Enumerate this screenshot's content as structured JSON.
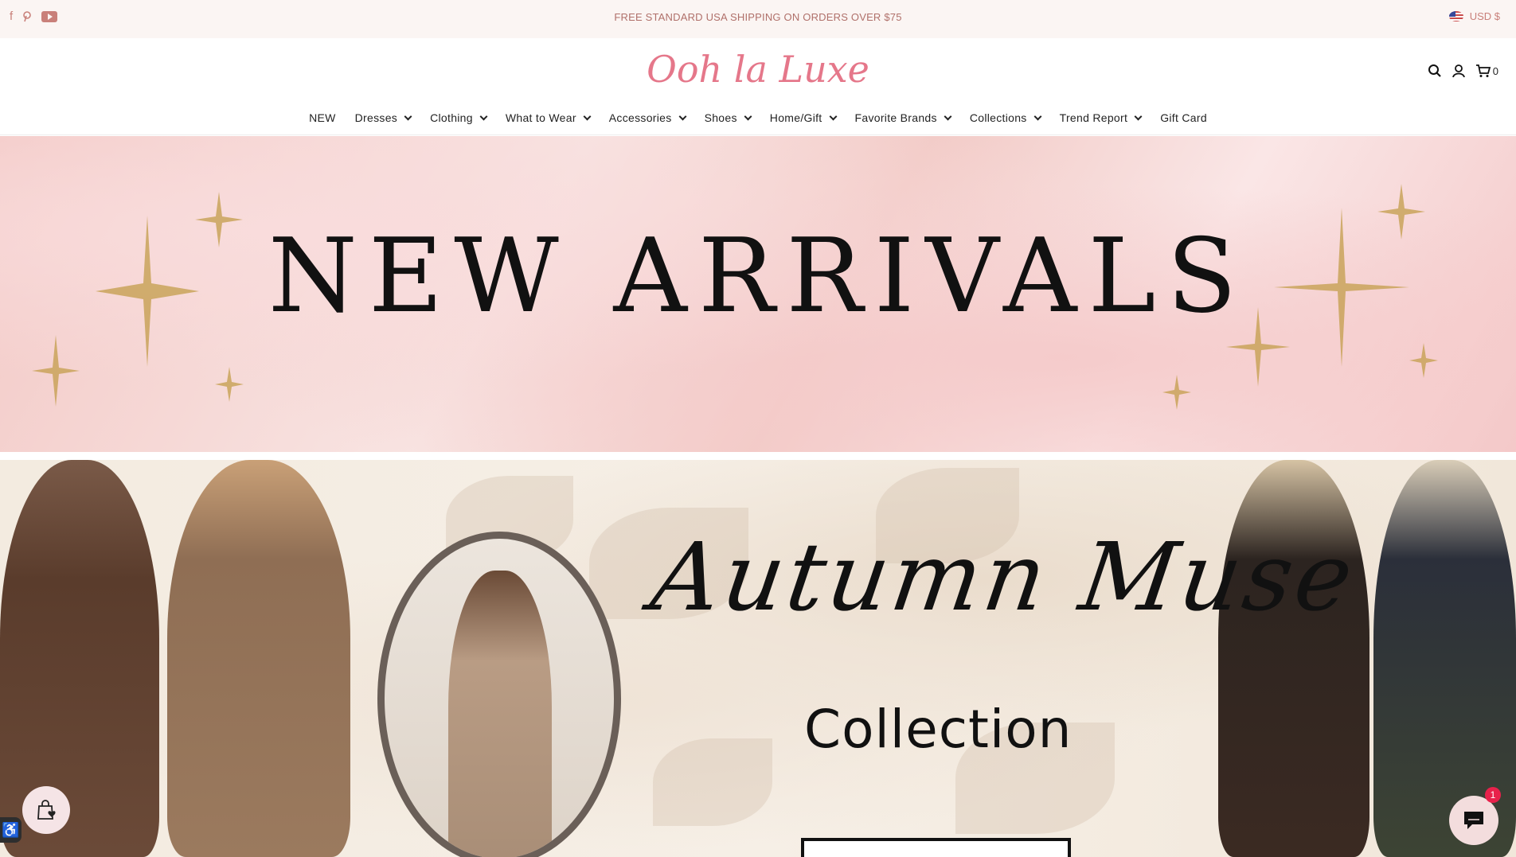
{
  "topbar": {
    "promo": "FREE STANDARD USA SHIPPING ON ORDERS OVER $75",
    "currency": "USD $",
    "social_icons": [
      "facebook-icon",
      "pinterest-icon",
      "youtube-icon"
    ]
  },
  "header": {
    "logo": "Ooh la Luxe",
    "cart_count": "0",
    "icons": [
      "search-icon",
      "account-icon",
      "cart-icon"
    ]
  },
  "nav": {
    "items": [
      {
        "label": "NEW",
        "dropdown": false
      },
      {
        "label": "Dresses",
        "dropdown": true
      },
      {
        "label": "Clothing",
        "dropdown": true
      },
      {
        "label": "What to Wear",
        "dropdown": true
      },
      {
        "label": "Accessories",
        "dropdown": true
      },
      {
        "label": "Shoes",
        "dropdown": true
      },
      {
        "label": "Home/Gift",
        "dropdown": true
      },
      {
        "label": "Favorite Brands",
        "dropdown": true
      },
      {
        "label": "Collections",
        "dropdown": true
      },
      {
        "label": "Trend Report",
        "dropdown": true
      },
      {
        "label": "Gift Card",
        "dropdown": false
      }
    ]
  },
  "hero": {
    "title": "NEW ARRIVALS"
  },
  "feature": {
    "script_title": "Autumn Muse",
    "subtitle": "Collection"
  },
  "chat": {
    "badge": "1"
  },
  "colors": {
    "accent": "#e5778a",
    "promo_text": "#b0706a",
    "topbar_bg": "#fbf5f3",
    "badge": "#e8214b"
  }
}
